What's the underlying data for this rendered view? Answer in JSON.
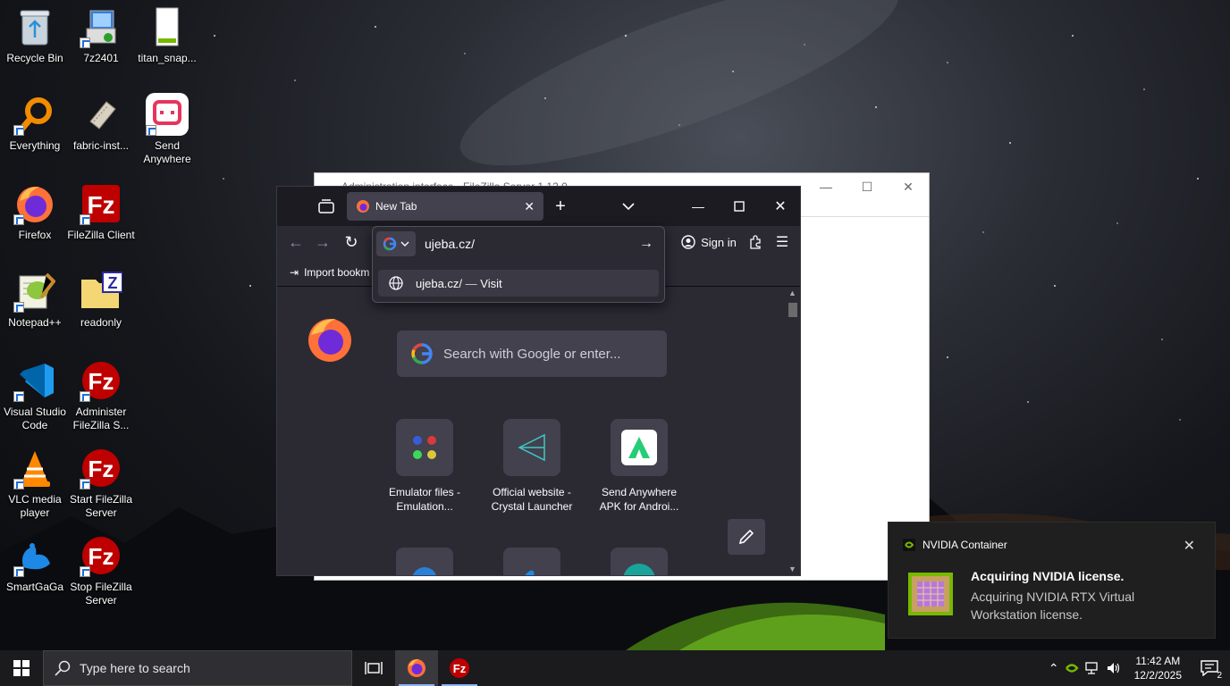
{
  "desktop": {
    "icons": [
      {
        "label": "Recycle Bin"
      },
      {
        "label": "7z2401"
      },
      {
        "label": "titan_snap..."
      },
      {
        "label": "Everything"
      },
      {
        "label": "fabric-inst..."
      },
      {
        "label": "Send Anywhere"
      },
      {
        "label": "Firefox"
      },
      {
        "label": "FileZilla Client"
      },
      {
        "label": "Notepad++"
      },
      {
        "label": "readonly"
      },
      {
        "label": "Visual Studio Code"
      },
      {
        "label": "Administer FileZilla S..."
      },
      {
        "label": "VLC media player"
      },
      {
        "label": "Start FileZilla Server"
      },
      {
        "label": "SmartGaGa"
      },
      {
        "label": "Stop FileZilla Server"
      }
    ]
  },
  "filezilla_admin": {
    "title": "Administration interface - FileZilla Server 1.12.0"
  },
  "firefox": {
    "tab_title": "New Tab",
    "url_value": "ujeba.cz/",
    "suggestion_url": "ujeba.cz/",
    "suggestion_sep": "—",
    "suggestion_action": "Visit",
    "bookmarks_import": "Import bookm",
    "sign_in": "Sign in",
    "search_placeholder": "Search with Google or enter...",
    "tiles": [
      {
        "label": "Emulator files - Emulation..."
      },
      {
        "label": "Official website - Crystal Launcher"
      },
      {
        "label": "Send Anywhere APK for Androi..."
      }
    ]
  },
  "notification": {
    "app": "NVIDIA Container",
    "title": "Acquiring NVIDIA license.",
    "body": "Acquiring NVIDIA RTX Virtual Workstation license."
  },
  "taskbar": {
    "search_placeholder": "Type here to search",
    "time": "11:42 AM",
    "date": "12/2/2025",
    "notification_count": "2"
  },
  "colors": {
    "firefox_bg": "#2b2a33",
    "firefox_tab": "#42414d",
    "filezilla_red": "#bf0000",
    "nvidia_green": "#76b900",
    "taskbar": "#1b1b1d"
  }
}
